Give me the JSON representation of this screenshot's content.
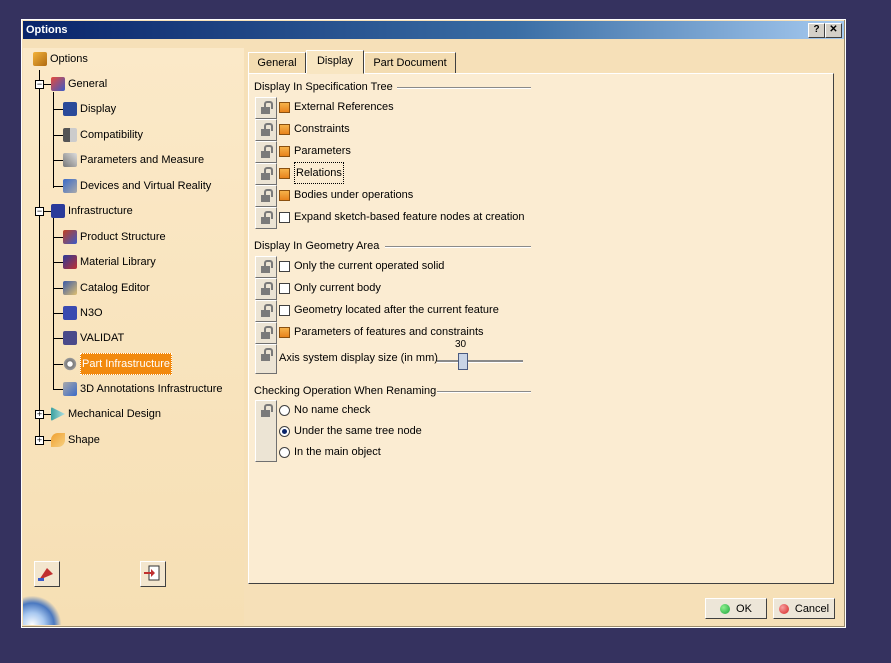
{
  "window": {
    "title": "Options",
    "help_label": "?",
    "close_label": "✕"
  },
  "tree": {
    "root": "Options",
    "items": [
      {
        "label": "General",
        "icon": "general-icon"
      },
      {
        "label": "Display",
        "icon": "display-icon"
      },
      {
        "label": "Compatibility",
        "icon": "compatibility-icon"
      },
      {
        "label": "Parameters and Measure",
        "icon": "parameters-icon"
      },
      {
        "label": "Devices and Virtual Reality",
        "icon": "devices-icon"
      },
      {
        "label": "Infrastructure",
        "icon": "infrastructure-icon"
      },
      {
        "label": "Product Structure",
        "icon": "product-structure-icon"
      },
      {
        "label": "Material Library",
        "icon": "material-library-icon"
      },
      {
        "label": "Catalog Editor",
        "icon": "catalog-editor-icon"
      },
      {
        "label": "N3O",
        "icon": "n3o-icon"
      },
      {
        "label": "VALIDAT",
        "icon": "validat-icon"
      },
      {
        "label": "Part Infrastructure",
        "icon": "gear-icon",
        "selected": true
      },
      {
        "label": "3D Annotations Infrastructure",
        "icon": "annotations-icon"
      },
      {
        "label": "Mechanical Design",
        "icon": "mechanical-design-icon"
      },
      {
        "label": "Shape",
        "icon": "shape-icon"
      }
    ]
  },
  "tabs": [
    {
      "label": "General"
    },
    {
      "label": "Display",
      "active": true
    },
    {
      "label": "Part Document"
    }
  ],
  "groups": {
    "spec_tree": {
      "title": "Display In Specification Tree",
      "options": [
        {
          "label": "External References",
          "checked": true
        },
        {
          "label": "Constraints",
          "checked": true
        },
        {
          "label": "Parameters",
          "checked": true
        },
        {
          "label": "Relations",
          "checked": true
        },
        {
          "label": "Bodies under operations",
          "checked": true
        },
        {
          "label": "Expand sketch-based feature nodes at creation",
          "checked": false
        }
      ]
    },
    "geometry": {
      "title": "Display In Geometry Area",
      "options": [
        {
          "label": "Only the current operated solid",
          "checked": false
        },
        {
          "label": "Only current body",
          "checked": false
        },
        {
          "label": "Geometry located after the current feature",
          "checked": false
        },
        {
          "label": "Parameters of features and constraints",
          "checked": true
        }
      ],
      "slider": {
        "label": "Axis system display size (in mm)",
        "value": "30",
        "min": 1,
        "max": 100
      }
    },
    "renaming": {
      "title": "Checking Operation When Renaming",
      "options": [
        {
          "label": "No name check",
          "selected": false
        },
        {
          "label": "Under the same tree node",
          "selected": true
        },
        {
          "label": "In the main object",
          "selected": false
        }
      ]
    }
  },
  "buttons": {
    "ok": "OK",
    "cancel": "Cancel"
  },
  "colors": {
    "accent": "#f28a0e",
    "ok_dot": "#1aa33a",
    "cancel_dot": "#d42020"
  }
}
